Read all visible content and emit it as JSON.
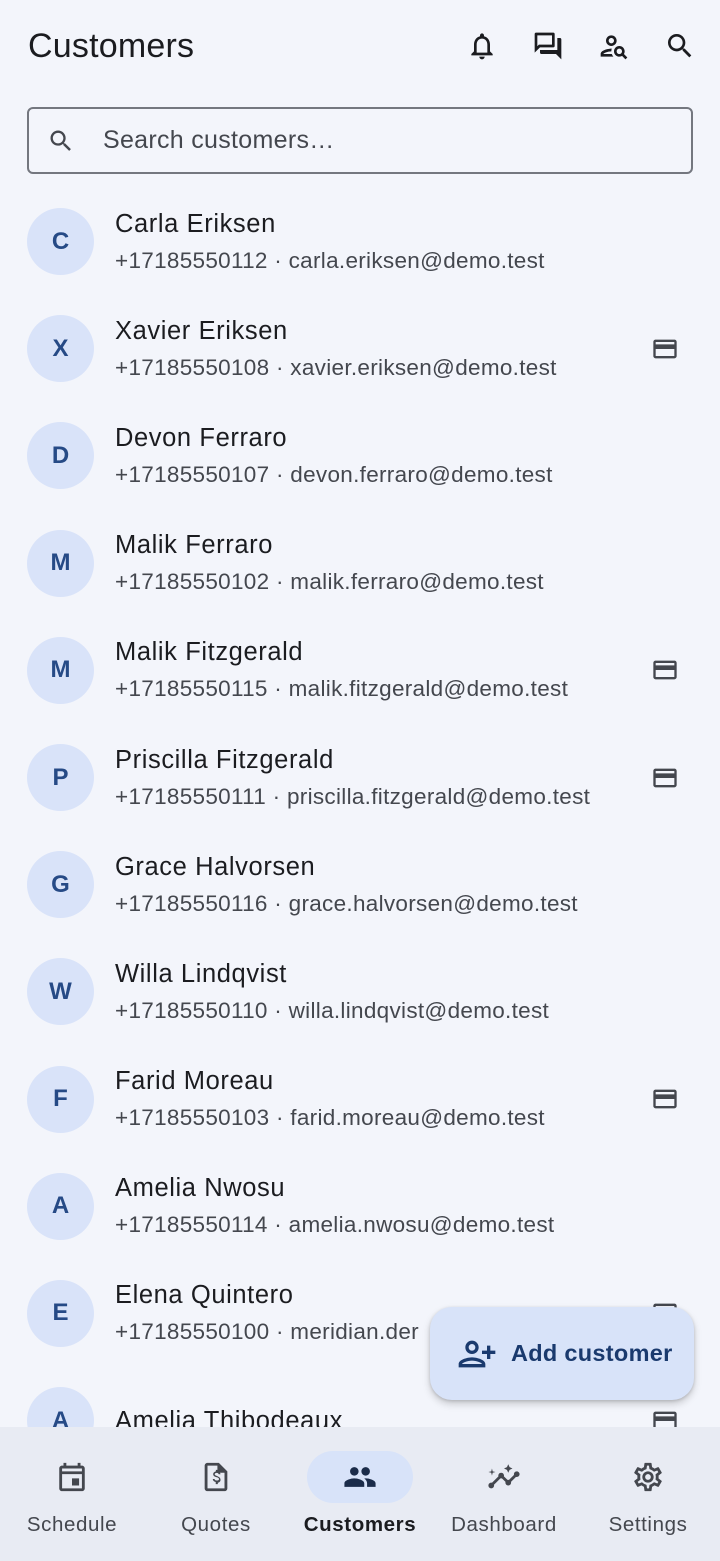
{
  "header": {
    "title": "Customers",
    "actions": [
      {
        "name": "notifications-bell-icon",
        "icon": "bell"
      },
      {
        "name": "messages-icon",
        "icon": "chat"
      },
      {
        "name": "person-search-icon",
        "icon": "person-search"
      },
      {
        "name": "search-icon",
        "icon": "search"
      }
    ]
  },
  "search": {
    "placeholder": "Search customers…"
  },
  "customers": [
    {
      "initial": "C",
      "name": "Carla Eriksen",
      "phone": "+17185550112",
      "email": "carla.eriksen@demo.test",
      "card": false
    },
    {
      "initial": "X",
      "name": "Xavier Eriksen",
      "phone": "+17185550108",
      "email": "xavier.eriksen@demo.test",
      "card": true
    },
    {
      "initial": "D",
      "name": "Devon Ferraro",
      "phone": "+17185550107",
      "email": "devon.ferraro@demo.test",
      "card": false
    },
    {
      "initial": "M",
      "name": "Malik Ferraro",
      "phone": "+17185550102",
      "email": "malik.ferraro@demo.test",
      "card": false
    },
    {
      "initial": "M",
      "name": "Malik Fitzgerald",
      "phone": "+17185550115",
      "email": "malik.fitzgerald@demo.test",
      "card": true
    },
    {
      "initial": "P",
      "name": "Priscilla Fitzgerald",
      "phone": "+17185550111",
      "email": "priscilla.fitzgerald@demo.test",
      "card": true
    },
    {
      "initial": "G",
      "name": "Grace Halvorsen",
      "phone": "+17185550116",
      "email": "grace.halvorsen@demo.test",
      "card": false
    },
    {
      "initial": "W",
      "name": "Willa Lindqvist",
      "phone": "+17185550110",
      "email": "willa.lindqvist@demo.test",
      "card": false
    },
    {
      "initial": "F",
      "name": "Farid Moreau",
      "phone": "+17185550103",
      "email": "farid.moreau@demo.test",
      "card": true
    },
    {
      "initial": "A",
      "name": "Amelia Nwosu",
      "phone": "+17185550114",
      "email": "amelia.nwosu@demo.test",
      "card": false
    },
    {
      "initial": "E",
      "name": "Elena Quintero",
      "phone": "+17185550100",
      "email": "meridian.der",
      "card": true
    },
    {
      "initial": "A",
      "name": "Amelia Thibodeaux",
      "phone": "",
      "email": "",
      "card": true
    }
  ],
  "separator": " · ",
  "fab": {
    "label": "Add customer",
    "icon": "person-add"
  },
  "nav": {
    "items": [
      {
        "label": "Schedule",
        "icon": "calendar",
        "active": false
      },
      {
        "label": "Quotes",
        "icon": "invoice-dollar",
        "active": false
      },
      {
        "label": "Customers",
        "icon": "group",
        "active": true
      },
      {
        "label": "Dashboard",
        "icon": "insights",
        "active": false
      },
      {
        "label": "Settings",
        "icon": "gear",
        "active": false
      }
    ]
  },
  "colors": {
    "background": "#f3f5fb",
    "avatar_bg": "#d9e3f9",
    "avatar_text": "#264a86",
    "fab_bg": "#d8e3f9",
    "nav_bg": "#e8ebf3",
    "nav_active_pill": "#d8e3f9"
  }
}
